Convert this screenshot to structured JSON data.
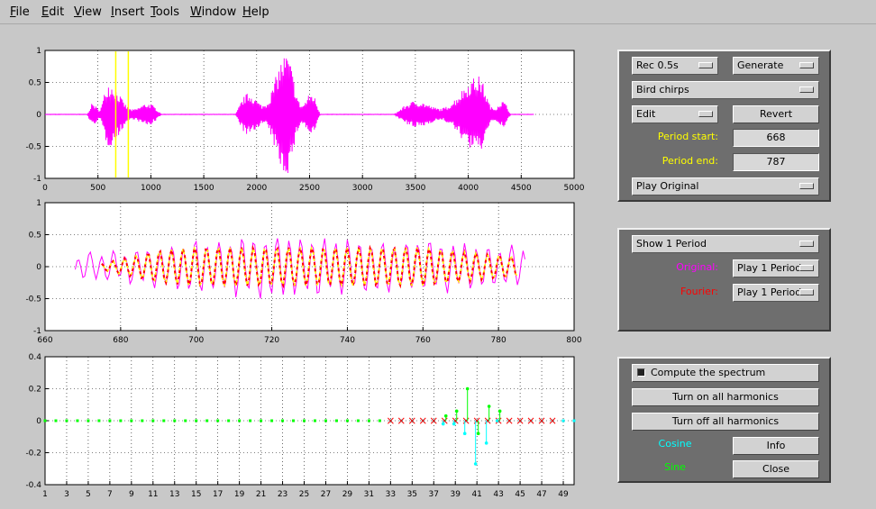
{
  "menu": [
    "File",
    "Edit",
    "View",
    "Insert",
    "Tools",
    "Window",
    "Help"
  ],
  "colors": {
    "signal": "#ff00ff",
    "fourier": "#ff0000",
    "period_marker": "#ffff00",
    "cosine": "#00ffff",
    "sine": "#00ff00"
  },
  "top_axes": {
    "x_ticks": [
      "0",
      "500",
      "1000",
      "1500",
      "2000",
      "2500",
      "3000",
      "3500",
      "4000",
      "4500",
      "5000"
    ],
    "y_ticks": [
      "1",
      "0.5",
      "0",
      "-0.5",
      "-1"
    ],
    "xlim": [
      0,
      5000
    ],
    "ylim": [
      -1,
      1
    ],
    "period_markers": [
      668,
      787
    ]
  },
  "mid_axes": {
    "x_ticks": [
      "660",
      "680",
      "700",
      "720",
      "740",
      "760",
      "780",
      "800"
    ],
    "y_ticks": [
      "1",
      "0.5",
      "0",
      "-0.5",
      "-1"
    ],
    "xlim": [
      660,
      800
    ],
    "ylim": [
      -1,
      1
    ]
  },
  "bot_axes": {
    "x_ticks": [
      "1",
      "3",
      "5",
      "7",
      "9",
      "11",
      "13",
      "15",
      "17",
      "19",
      "21",
      "23",
      "25",
      "27",
      "29",
      "31",
      "33",
      "35",
      "37",
      "39",
      "41",
      "43",
      "45",
      "47",
      "49"
    ],
    "y_ticks": [
      "0.4",
      "0.2",
      "0",
      "-0.2",
      "-0.4"
    ],
    "xlim": [
      1,
      50
    ],
    "ylim": [
      -0.4,
      0.4
    ]
  },
  "panel1": {
    "rec_popup": "Rec 0.5s",
    "generate_popup": "Generate",
    "source_popup": "Bird chirps",
    "edit_popup": "Edit",
    "revert_button": "Revert",
    "period_start_label": "Period start:",
    "period_start_value": "668",
    "period_end_label": "Period end:",
    "period_end_value": "787",
    "play_popup": "Play Original"
  },
  "panel2": {
    "show_popup": "Show 1 Period",
    "original_label": "Original:",
    "original_popup": "Play 1 Period",
    "fourier_label": "Fourier:",
    "fourier_popup": "Play 1 Period"
  },
  "panel3": {
    "compute_checkbox": "Compute the spectrum",
    "turn_on_button": "Turn on all harmonics",
    "turn_off_button": "Turn off all harmonics",
    "cosine_label": "Cosine",
    "sine_label": "Sine",
    "info_button": "Info",
    "close_button": "Close"
  },
  "chart_data": [
    {
      "type": "line",
      "series": [
        {
          "segments": [
            {
              "x_range": [
                400,
                1100
              ],
              "peak_at": 600,
              "amplitude": 0.5
            },
            {
              "x_range": [
                1800,
                2600
              ],
              "peak_at": 2280,
              "amplitude": 0.95
            },
            {
              "x_range": [
                3300,
                4400
              ],
              "peak_at": 4100,
              "amplitude": 0.6
            }
          ]
        }
      ],
      "xlim": [
        0,
        5000
      ],
      "ylim": [
        -1,
        1
      ],
      "grid": true
    },
    {
      "type": "line",
      "series": [
        {
          "oscillation_period": 3.1,
          "envelope": [
            [
              668,
              0.2
            ],
            [
              690,
              0.3
            ],
            [
              700,
              0.4
            ],
            [
              720,
              0.5
            ],
            [
              740,
              0.45
            ],
            [
              760,
              0.4
            ],
            [
              787,
              0.3
            ]
          ]
        },
        {
          "oscillation_period": 3.1,
          "envelope": [
            [
              675,
              0.05
            ],
            [
              690,
              0.25
            ],
            [
              700,
              0.3
            ],
            [
              720,
              0.3
            ],
            [
              760,
              0.3
            ],
            [
              785,
              0.15
            ]
          ]
        }
      ],
      "xlim": [
        660,
        800
      ],
      "ylim": [
        -1,
        1
      ],
      "grid": true
    },
    {
      "type": "scatter",
      "series": [
        {
          "harmonics": [
            38,
            39,
            40,
            41,
            42,
            43
          ],
          "values": [
            -0.02,
            -0.02,
            -0.08,
            -0.27,
            -0.14,
            0.0
          ]
        },
        {
          "harmonics": [
            38,
            39,
            40,
            41,
            42,
            43
          ],
          "values": [
            0.03,
            0.06,
            0.2,
            -0.08,
            0.09,
            0.06
          ]
        }
      ],
      "xlim": [
        1,
        50
      ],
      "ylim": [
        -0.4,
        0.4
      ],
      "grid": true
    }
  ]
}
